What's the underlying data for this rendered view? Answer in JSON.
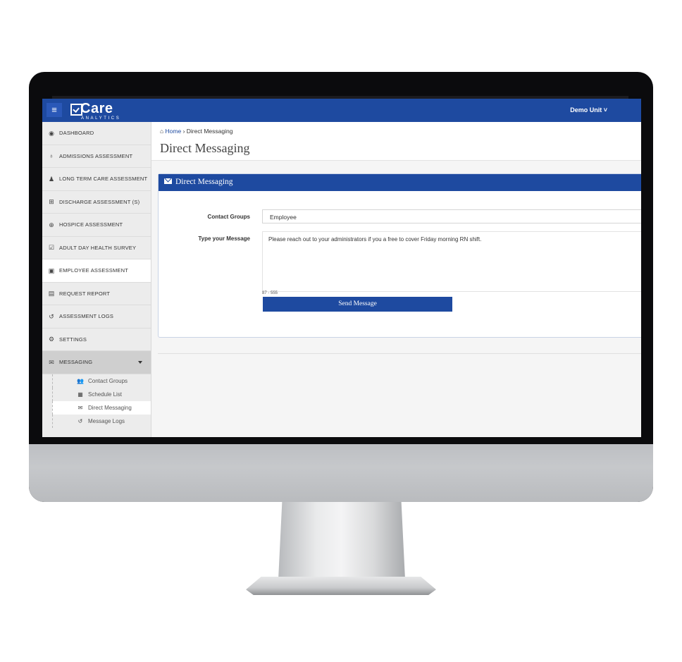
{
  "app": {
    "logo_text": "Care",
    "logo_subtext": "ANALYTICS",
    "user_menu": "Demo Unit",
    "menu_icon": "hamburger-icon"
  },
  "breadcrumb": {
    "home": "Home",
    "current": "Direct Messaging"
  },
  "page": {
    "title": "Direct Messaging"
  },
  "sidebar": {
    "items": [
      {
        "label": "DASHBOARD",
        "icon": "dashboard-icon"
      },
      {
        "label": "ADMISSIONS ASSESSMENT",
        "icon": "stethoscope-icon"
      },
      {
        "label": "LONG TERM CARE ASSESSMENT",
        "icon": "user-nurse-icon"
      },
      {
        "label": "DISCHARGE ASSESSMENT (S)",
        "icon": "plus-square-icon"
      },
      {
        "label": "HOSPICE ASSESSMENT",
        "icon": "plus-circle-icon"
      },
      {
        "label": "ADULT DAY HEALTH SURVEY",
        "icon": "checkbox-icon"
      },
      {
        "label": "EMPLOYEE ASSESSMENT",
        "icon": "medkit-icon"
      },
      {
        "label": "REQUEST REPORT",
        "icon": "pdf-file-icon"
      },
      {
        "label": "ASSESSMENT LOGS",
        "icon": "history-icon"
      },
      {
        "label": "SETTINGS",
        "icon": "gears-icon"
      },
      {
        "label": "MESSAGING",
        "icon": "envelope-icon"
      }
    ],
    "messaging_sub": [
      {
        "label": "Contact Groups",
        "icon": "users-icon"
      },
      {
        "label": "Schedule List",
        "icon": "calendar-icon"
      },
      {
        "label": "Direct Messaging",
        "icon": "envelope-icon"
      },
      {
        "label": "Message Logs",
        "icon": "history-icon"
      }
    ]
  },
  "panel": {
    "title": "Direct Messaging",
    "contact_groups_label": "Contact Groups",
    "contact_groups_value": "Employee",
    "message_label": "Type your Message",
    "message_value": "Please reach out to your administrators if you a free to cover Friday morning RN shift.",
    "counter": "87 - 555",
    "send_label": "Send Message"
  },
  "colors": {
    "brand_blue": "#1e4aa0",
    "sidebar_bg": "#ececec"
  }
}
